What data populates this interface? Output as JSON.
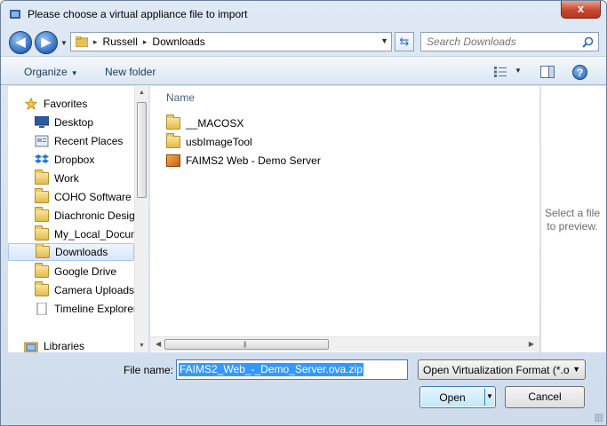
{
  "window": {
    "title": "Please choose a virtual appliance file to import",
    "close_label": "x"
  },
  "nav": {
    "back_label": "◀",
    "forward_label": "▶"
  },
  "address": {
    "crumbs": [
      "Russell",
      "Downloads"
    ],
    "separator": "▸"
  },
  "search": {
    "placeholder": "Search Downloads"
  },
  "toolbar": {
    "organize_label": "Organize",
    "new_folder_label": "New folder",
    "help_label": "?"
  },
  "sidebar": {
    "items": [
      {
        "label": "Favorites",
        "icon": "star-icon"
      },
      {
        "label": "Desktop",
        "icon": "desktop-icon"
      },
      {
        "label": "Recent Places",
        "icon": "recent-places-icon"
      },
      {
        "label": "Dropbox",
        "icon": "dropbox-icon"
      },
      {
        "label": "Work",
        "icon": "folder-icon"
      },
      {
        "label": "COHO Software",
        "icon": "folder-icon"
      },
      {
        "label": "Diachronic Design",
        "icon": "folder-icon"
      },
      {
        "label": "My_Local_Documents",
        "icon": "folder-icon"
      },
      {
        "label": "Downloads",
        "icon": "downloads-icon",
        "selected": true
      },
      {
        "label": "Google Drive",
        "icon": "folder-icon"
      },
      {
        "label": "Camera Uploads",
        "icon": "folder-icon"
      },
      {
        "label": "Timeline Explorer",
        "icon": "document-icon"
      },
      {
        "label": "Libraries",
        "icon": "libraries-icon"
      }
    ]
  },
  "filelist": {
    "column_header": "Name",
    "items": [
      {
        "label": "__MACOSX",
        "icon": "folder-icon"
      },
      {
        "label": "usbImageTool",
        "icon": "folder-icon"
      },
      {
        "label": "FAIMS2 Web - Demo Server",
        "icon": "virtual-appliance-icon"
      }
    ]
  },
  "preview": {
    "message": "Select a file to preview."
  },
  "footer": {
    "file_name_label": "File name:",
    "file_name_value": "FAIMS2_Web_-_Demo_Server.ova.zip",
    "file_type_value": "Open Virtualization Format (*.ova;*.ovf)",
    "open_label": "Open",
    "cancel_label": "Cancel"
  },
  "colors": {
    "accent": "#3399ff",
    "selection_bg": "#d7e7fa",
    "frame": "#cfdcec"
  }
}
